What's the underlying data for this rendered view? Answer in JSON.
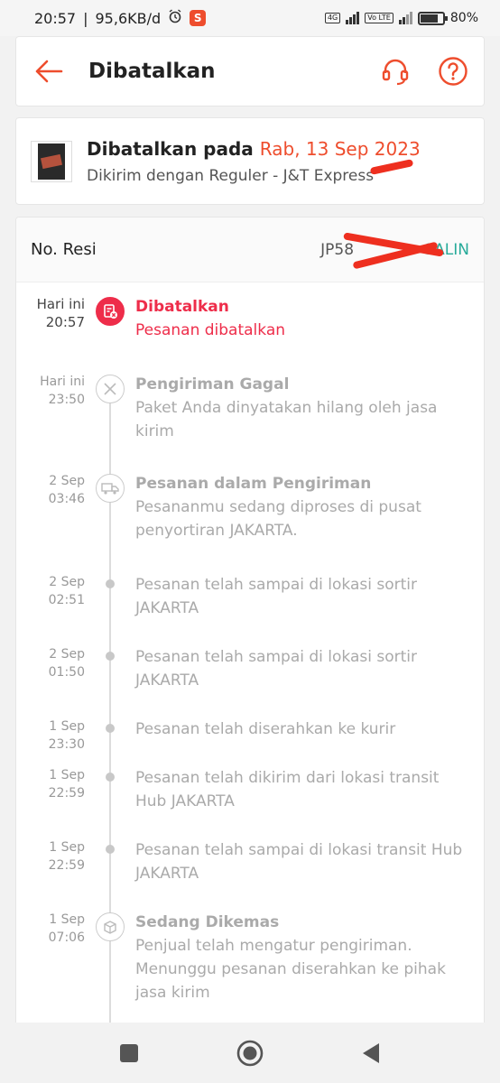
{
  "status_bar": {
    "time": "20:57",
    "net_speed": "95,6KB/d",
    "battery": "80",
    "network_4g": "4G",
    "volte": "Vo LTE"
  },
  "header": {
    "title": "Dibatalkan"
  },
  "order": {
    "cancel_prefix": "Dibatalkan pada",
    "cancel_date": "Rab, 13 Sep 2023",
    "shipping": "Dikirim dengan Reguler - J&T Express"
  },
  "resi": {
    "label": "No. Resi",
    "number": "JP58",
    "copy_label": "SALIN"
  },
  "events": [
    {
      "day": "Hari ini",
      "time": "20:57",
      "title": "Dibatalkan",
      "desc": "Pesanan dibatalkan",
      "icon": "cancel-doc-icon"
    },
    {
      "day": "Hari ini",
      "time": "23:50",
      "title": "Pengiriman Gagal",
      "desc": "Paket Anda dinyatakan hilang oleh jasa kirim",
      "icon": "x-circle-icon"
    },
    {
      "day": "2 Sep",
      "time": "03:46",
      "title": "Pesanan dalam Pengiriman",
      "desc": "Pesananmu sedang diproses di pusat penyortiran JAKARTA.",
      "icon": "truck-icon"
    },
    {
      "day": "2 Sep",
      "time": "02:51",
      "title": "",
      "desc": "Pesanan telah sampai di lokasi sortir JAKARTA",
      "icon": "dot"
    },
    {
      "day": "2 Sep",
      "time": "01:50",
      "title": "",
      "desc": "Pesanan telah sampai di lokasi sortir JAKARTA",
      "icon": "dot"
    },
    {
      "day": "1 Sep",
      "time": "23:30",
      "title": "",
      "desc": "Pesanan telah diserahkan ke kurir",
      "icon": "dot"
    },
    {
      "day": "1 Sep",
      "time": "22:59",
      "title": "",
      "desc": "Pesanan telah dikirim dari lokasi transit Hub JAKARTA",
      "icon": "dot"
    },
    {
      "day": "1 Sep",
      "time": "22:59",
      "title": "",
      "desc": "Pesanan telah sampai di lokasi transit Hub JAKARTA",
      "icon": "dot"
    },
    {
      "day": "1 Sep",
      "time": "07:06",
      "title": "Sedang Dikemas",
      "desc": "Penjual telah mengatur pengiriman. Menunggu pesanan diserahkan ke pihak jasa kirim",
      "icon": "package-icon"
    }
  ],
  "colors": {
    "accent": "#ee4d2d",
    "active": "#ee2d4a",
    "copy": "#26aa99",
    "muted": "#aaaaaa"
  }
}
